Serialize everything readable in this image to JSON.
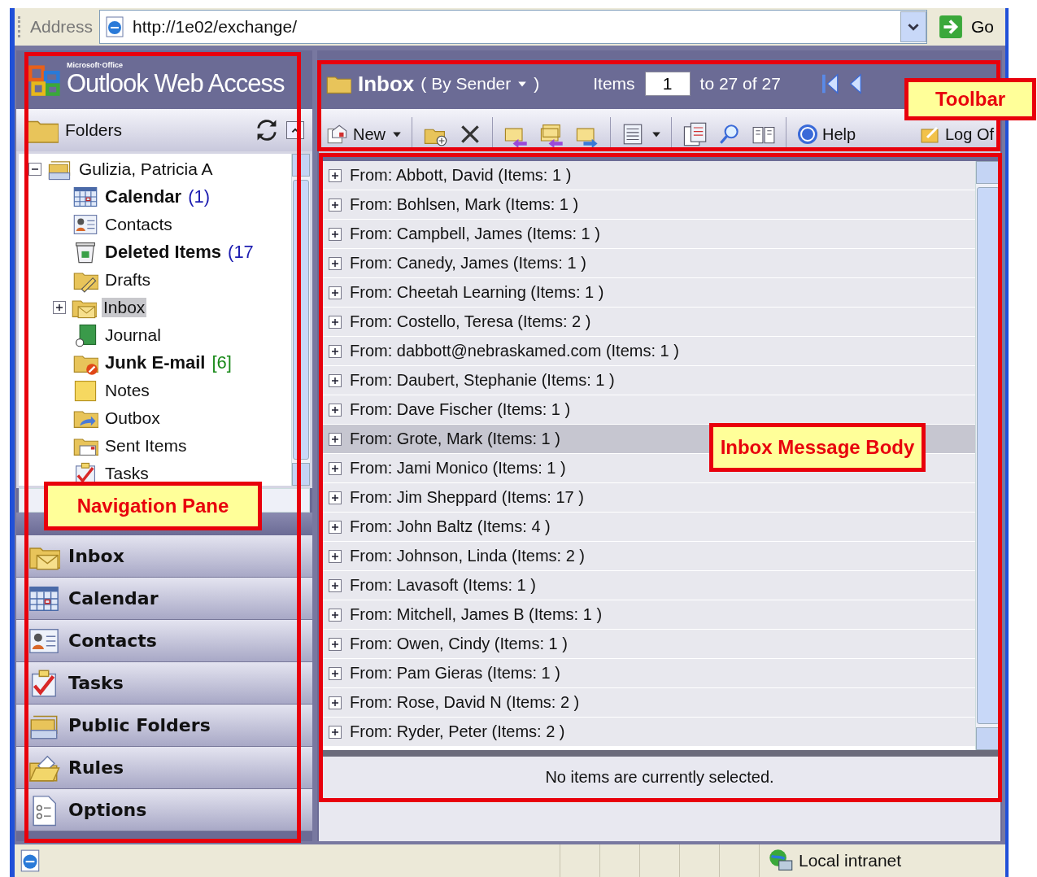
{
  "address_bar": {
    "label": "Address",
    "url": "http://1e02/exchange/",
    "go": "Go"
  },
  "navigation": {
    "brand_small": "Microsoft·Office",
    "brand": "Outlook Web Access",
    "folders_title": "Folders",
    "tree": {
      "label": "Gulizia, Patricia A",
      "expanded": true,
      "children": [
        {
          "label": "Calendar",
          "bold": true,
          "count": {
            "text": "(1)",
            "color": "#1c1cb0"
          },
          "selected": false
        },
        {
          "label": "Contacts",
          "bold": false,
          "selected": false
        },
        {
          "label": "Deleted Items",
          "bold": true,
          "count": {
            "text": "(17",
            "color": "#1c1cb0"
          },
          "selected": false
        },
        {
          "label": "Drafts",
          "bold": false,
          "selected": false
        },
        {
          "label": "Inbox",
          "bold": false,
          "selected": true,
          "expanded": false
        },
        {
          "label": "Journal",
          "bold": false,
          "selected": false
        },
        {
          "label": "Junk E-mail",
          "bold": true,
          "count": {
            "text": "[6]",
            "color": "#1a8a1a"
          },
          "selected": false
        },
        {
          "label": "Notes",
          "bold": false,
          "selected": false
        },
        {
          "label": "Outbox",
          "bold": false,
          "selected": false
        },
        {
          "label": "Sent Items",
          "bold": false,
          "selected": false
        },
        {
          "label": "Tasks",
          "bold": false,
          "selected": false
        }
      ]
    },
    "buttons": [
      "Inbox",
      "Calendar",
      "Contacts",
      "Tasks",
      "Public Folders",
      "Rules",
      "Options"
    ]
  },
  "header": {
    "folder": "Inbox",
    "view_open": "(",
    "view": "By Sender",
    "view_close": ")",
    "items_label": "Items",
    "page_value": "1",
    "range": "to 27 of 27"
  },
  "toolbar": {
    "new": "New",
    "help": "Help",
    "log_off": "Log Of"
  },
  "messages": [
    {
      "label": "From: Abbott, David (Items: 1 )",
      "expanded": false,
      "selected": false
    },
    {
      "label": "From: Bohlsen, Mark (Items: 1 )",
      "expanded": false,
      "selected": false
    },
    {
      "label": "From: Campbell, James (Items: 1 )",
      "expanded": false,
      "selected": false
    },
    {
      "label": "From: Canedy, James (Items: 1 )",
      "expanded": false,
      "selected": false
    },
    {
      "label": "From: Cheetah Learning (Items: 1 )",
      "expanded": false,
      "selected": false
    },
    {
      "label": "From: Costello, Teresa (Items: 2 )",
      "expanded": false,
      "selected": false
    },
    {
      "label": "From: dabbott@nebraskamed.com (Items: 1 )",
      "expanded": false,
      "selected": false
    },
    {
      "label": "From: Daubert, Stephanie (Items: 1 )",
      "expanded": false,
      "selected": false
    },
    {
      "label": "From: Dave Fischer (Items: 1 )",
      "expanded": false,
      "selected": false
    },
    {
      "label": "From: Grote, Mark (Items: 1 )",
      "expanded": false,
      "selected": true
    },
    {
      "label": "From: Jami Monico (Items: 1 )",
      "expanded": false,
      "selected": false
    },
    {
      "label": "From: Jim Sheppard (Items: 17 )",
      "expanded": false,
      "selected": false
    },
    {
      "label": "From: John Baltz (Items: 4 )",
      "expanded": false,
      "selected": false
    },
    {
      "label": "From: Johnson, Linda (Items: 2 )",
      "expanded": false,
      "selected": false
    },
    {
      "label": "From: Lavasoft (Items: 1 )",
      "expanded": false,
      "selected": false
    },
    {
      "label": "From: Mitchell, James B (Items: 1 )",
      "expanded": false,
      "selected": false
    },
    {
      "label": "From: Owen, Cindy (Items: 1 )",
      "expanded": false,
      "selected": false
    },
    {
      "label": "From: Pam Gieras (Items: 1 )",
      "expanded": false,
      "selected": false
    },
    {
      "label": "From: Rose, David N (Items: 2 )",
      "expanded": false,
      "selected": false
    },
    {
      "label": "From: Ryder, Peter (Items: 2 )",
      "expanded": false,
      "selected": false
    }
  ],
  "reading_pane": "No items are currently selected.",
  "status_bar": {
    "zone": "Local intranet"
  },
  "annotations": [
    "Toolbar",
    "Navigation Pane",
    "Inbox Message Body"
  ]
}
